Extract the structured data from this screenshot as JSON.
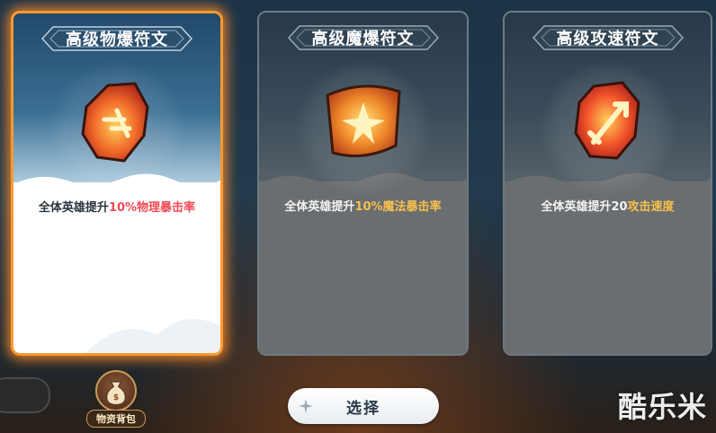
{
  "cards": [
    {
      "title": "高级物爆符文",
      "selected": true,
      "desc_prefix": "全体英雄提升",
      "desc_highlight": "10%物理暴击率",
      "highlight_color": "#ef4a55",
      "icon": "crit-rune-icon"
    },
    {
      "title": "高级魔爆符文",
      "selected": false,
      "desc_prefix": "全体英雄提升",
      "desc_highlight": "10%魔法暴击率",
      "highlight_color": "#f5c04d",
      "icon": "magic-rune-icon"
    },
    {
      "title": "高级攻速符文",
      "selected": false,
      "desc_prefix": "全体英雄提升20",
      "desc_highlight": "攻击速度",
      "highlight_color": "#f5c04d",
      "icon": "attack-speed-rune-icon"
    }
  ],
  "select_button": {
    "label": "选择",
    "icon": "sparkle-icon"
  },
  "inventory": {
    "label": "物资背包",
    "icon": "bag-icon"
  },
  "watermark": "酷乐米",
  "colors": {
    "selected_glow": "#ff9a2e",
    "accent_red": "#ef4a55",
    "accent_gold": "#f5c04d"
  }
}
